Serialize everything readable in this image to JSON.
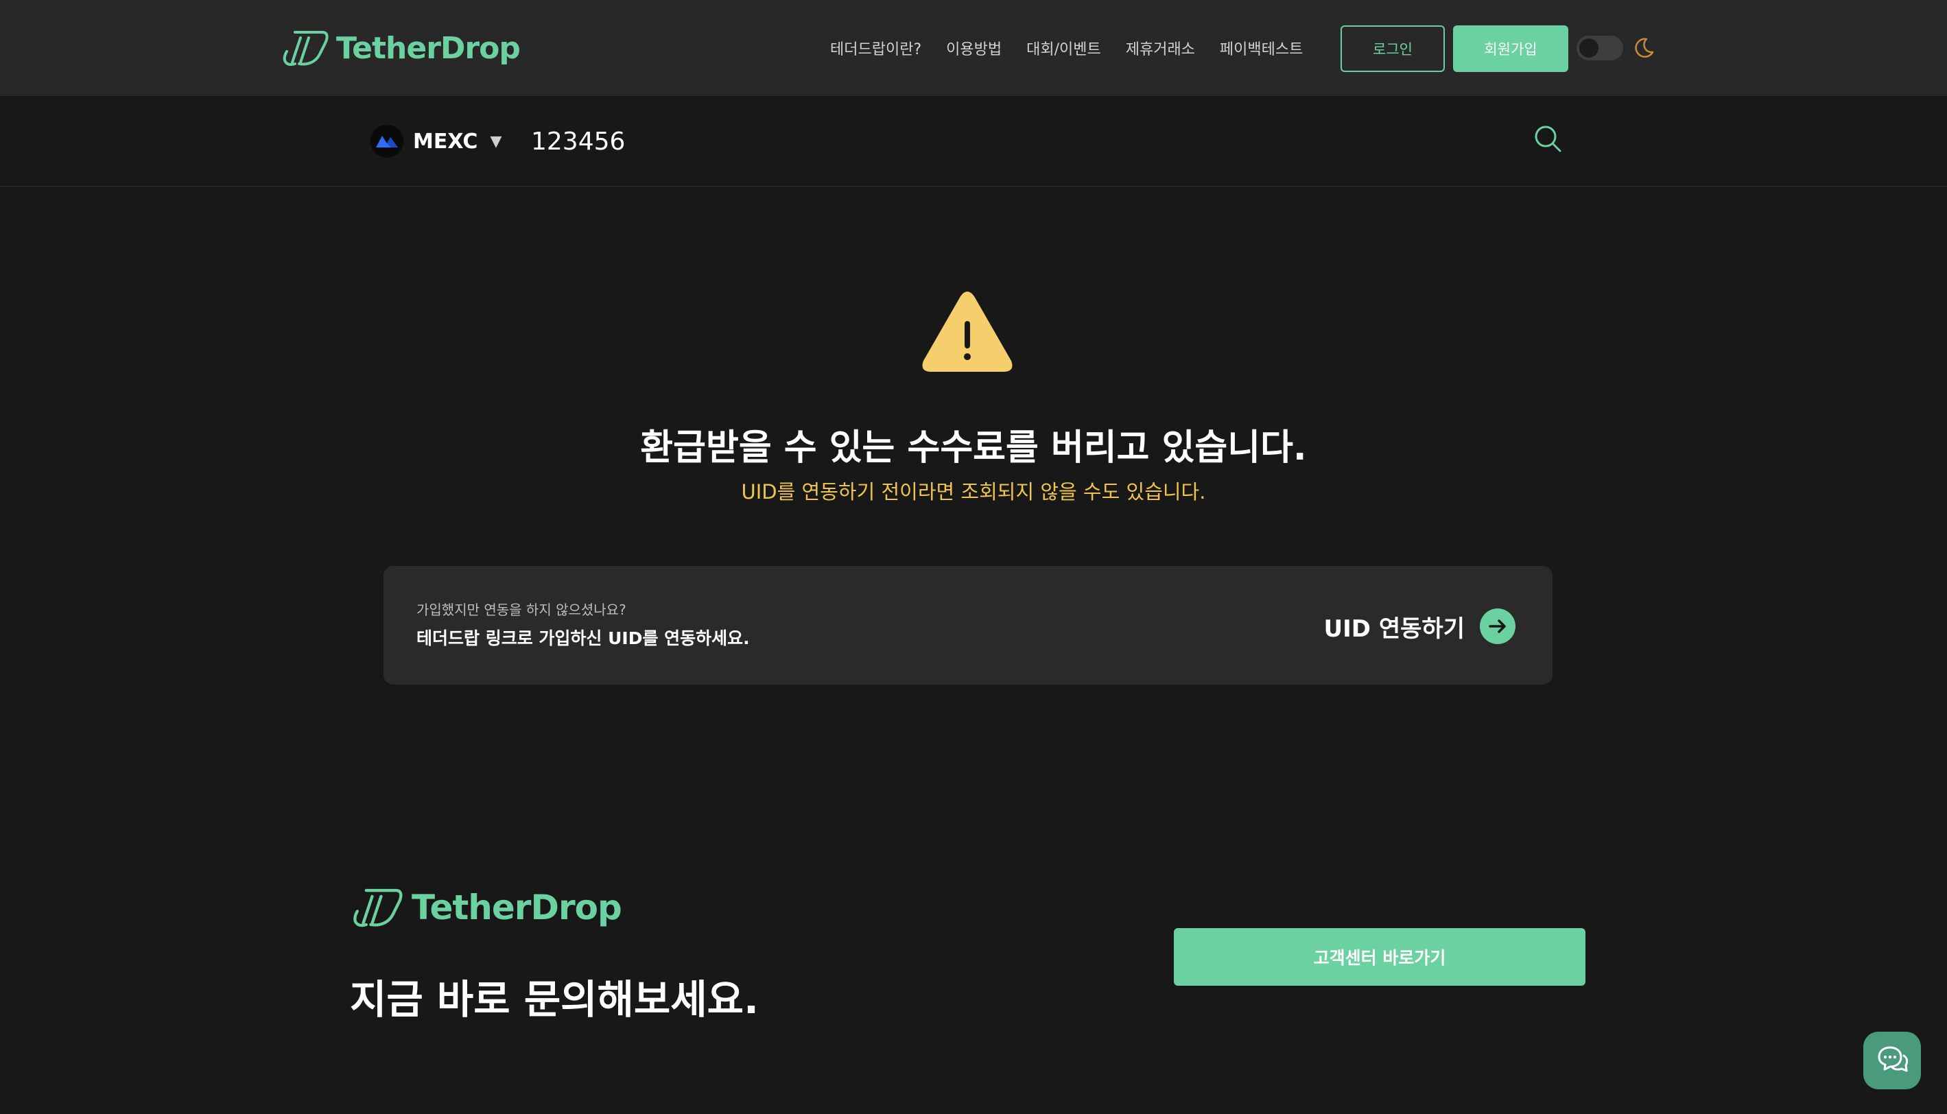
{
  "header": {
    "logo_text": "TetherDrop",
    "nav": [
      "테더드랍이란?",
      "이용방법",
      "대회/이벤트",
      "제휴거래소",
      "페이백테스트"
    ],
    "login_label": "로그인",
    "signup_label": "회원가입",
    "theme_icon": "moon-icon"
  },
  "search": {
    "exchange": "MEXC",
    "uid_value": "123456",
    "search_icon": "search-icon"
  },
  "warning": {
    "icon": "warning-icon",
    "title": "환급받을 수 있는 수수료를 버리고 있습니다.",
    "subtitle": "UID를 연동하기 전이라면 조회되지 않을 수도 있습니다."
  },
  "uid_card": {
    "question": "가입했지만 연동을 하지 않으셨나요?",
    "description": "테더드랍 링크로 가입하신 UID를 연동하세요.",
    "link_label": "UID 연동하기"
  },
  "footer": {
    "logo_text": "TetherDrop",
    "title": "지금 바로 문의해보세요.",
    "support_button": "고객센터 바로가기"
  },
  "colors": {
    "accent": "#6cd1a0",
    "warning": "#f0c54a",
    "background": "#181818",
    "header_bg": "#282828",
    "card_bg": "#2a2a2a"
  }
}
